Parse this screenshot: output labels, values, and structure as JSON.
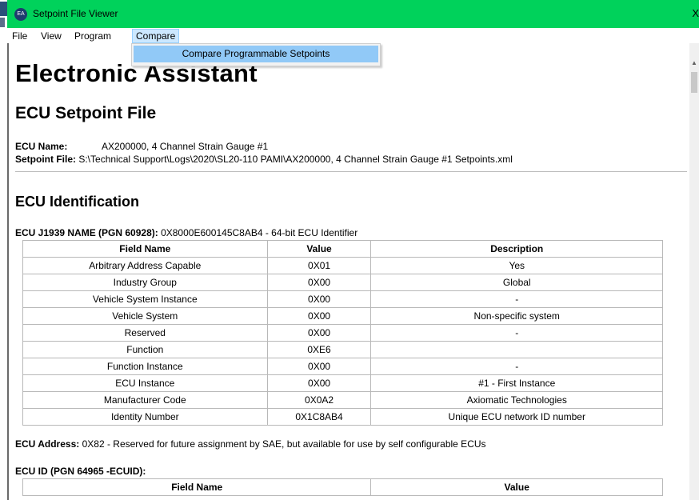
{
  "window": {
    "title": "Setpoint File Viewer",
    "close_glyph": "X",
    "icon_text": "EA"
  },
  "menu": {
    "items": [
      "File",
      "View",
      "Program",
      "Compare"
    ],
    "active": "Compare",
    "dropdown_items": [
      "Compare Programmable Setpoints"
    ]
  },
  "doc": {
    "heading": "Electronic Assistant",
    "subheading": "ECU Setpoint File",
    "ecu_name_label": "ECU Name:",
    "ecu_name_value": "AX200000, 4 Channel Strain Gauge #1",
    "setpoint_file_label": "Setpoint File:",
    "setpoint_file_value": "S:\\Technical Support\\Logs\\2020\\SL20-110 PAMI\\AX200000, 4 Channel Strain Gauge #1 Setpoints.xml",
    "section_title": "ECU Identification",
    "name_label": "ECU J1939 NAME (PGN 60928):",
    "name_value": "0X8000E600145C8AB4 - 64-bit ECU Identifier",
    "address_label": "ECU Address:",
    "address_value": "0X82 - Reserved for future assignment by SAE, but available for use by self configurable ECUs",
    "ecuid_label": "ECU ID (PGN 64965 -ECUID):"
  },
  "name_table": {
    "headers": [
      "Field Name",
      "Value",
      "Description"
    ],
    "rows": [
      [
        "Arbitrary Address Capable",
        "0X01",
        "Yes"
      ],
      [
        "Industry Group",
        "0X00",
        "Global"
      ],
      [
        "Vehicle System Instance",
        "0X00",
        "-"
      ],
      [
        "Vehicle System",
        "0X00",
        "Non-specific system"
      ],
      [
        "Reserved",
        "0X00",
        "-"
      ],
      [
        "Function",
        "0XE6",
        ""
      ],
      [
        "Function Instance",
        "0X00",
        "-"
      ],
      [
        "ECU Instance",
        "0X00",
        "#1 - First Instance"
      ],
      [
        "Manufacturer Code",
        "0X0A2",
        "Axiomatic Technologies"
      ],
      [
        "Identity Number",
        "0X1C8AB4",
        "Unique ECU network ID number"
      ]
    ]
  },
  "ecuid_table": {
    "headers": [
      "Field Name",
      "Value"
    ]
  }
}
